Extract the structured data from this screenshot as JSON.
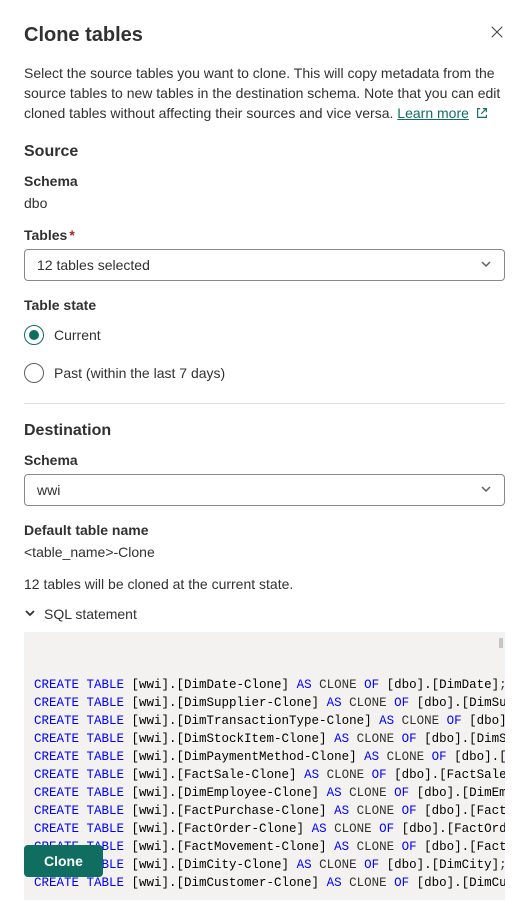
{
  "title": "Clone tables",
  "description_prefix": "Select the source tables you want to clone. This will copy metadata from the source tables to new tables in the destination schema. Note that you can edit cloned tables without affecting their sources and vice versa. ",
  "learn_more_label": "Learn more",
  "source": {
    "heading": "Source",
    "schema_label": "Schema",
    "schema_value": "dbo",
    "tables_label": "Tables",
    "tables_selected": "12 tables selected",
    "table_state_label": "Table state",
    "state_options": {
      "current": "Current",
      "past": "Past (within the last 7 days)"
    }
  },
  "destination": {
    "heading": "Destination",
    "schema_label": "Schema",
    "schema_value": "wwi",
    "default_name_label": "Default table name",
    "default_name_value": "<table_name>-Clone"
  },
  "status_line": "12 tables will be cloned at the current state.",
  "sql_header": "SQL statement",
  "sql_lines": [
    {
      "dest": "[wwi].[DimDate-Clone]",
      "src": "[dbo].[DimDate]",
      "term": ";"
    },
    {
      "dest": "[wwi].[DimSupplier-Clone]",
      "src": "[dbo].[DimSupplier]",
      "term": ";"
    },
    {
      "dest": "[wwi].[DimTransactionType-Clone]",
      "src": "[dbo].[DimTra",
      "term": ""
    },
    {
      "dest": "[wwi].[DimStockItem-Clone]",
      "src": "[dbo].[DimStockItem",
      "term": ""
    },
    {
      "dest": "[wwi].[DimPaymentMethod-Clone]",
      "src": "[dbo].[DimPayme",
      "term": ""
    },
    {
      "dest": "[wwi].[FactSale-Clone]",
      "src": "[dbo].[FactSale]",
      "term": ";"
    },
    {
      "dest": "[wwi].[DimEmployee-Clone]",
      "src": "[dbo].[DimEmployee]",
      "term": ";"
    },
    {
      "dest": "[wwi].[FactPurchase-Clone]",
      "src": "[dbo].[FactPurchase",
      "term": ""
    },
    {
      "dest": "[wwi].[FactOrder-Clone]",
      "src": "[dbo].[FactOrder]",
      "term": ";"
    },
    {
      "dest": "[wwi].[FactMovement-Clone]",
      "src": "[dbo].[FactMovement",
      "term": ""
    },
    {
      "dest": "[wwi].[DimCity-Clone]",
      "src": "[dbo].[DimCity]",
      "term": ";"
    },
    {
      "dest": "[wwi].[DimCustomer-Clone]",
      "src": "[dbo].[DimCustomer]",
      "term": ";"
    }
  ],
  "clone_button": "Clone"
}
